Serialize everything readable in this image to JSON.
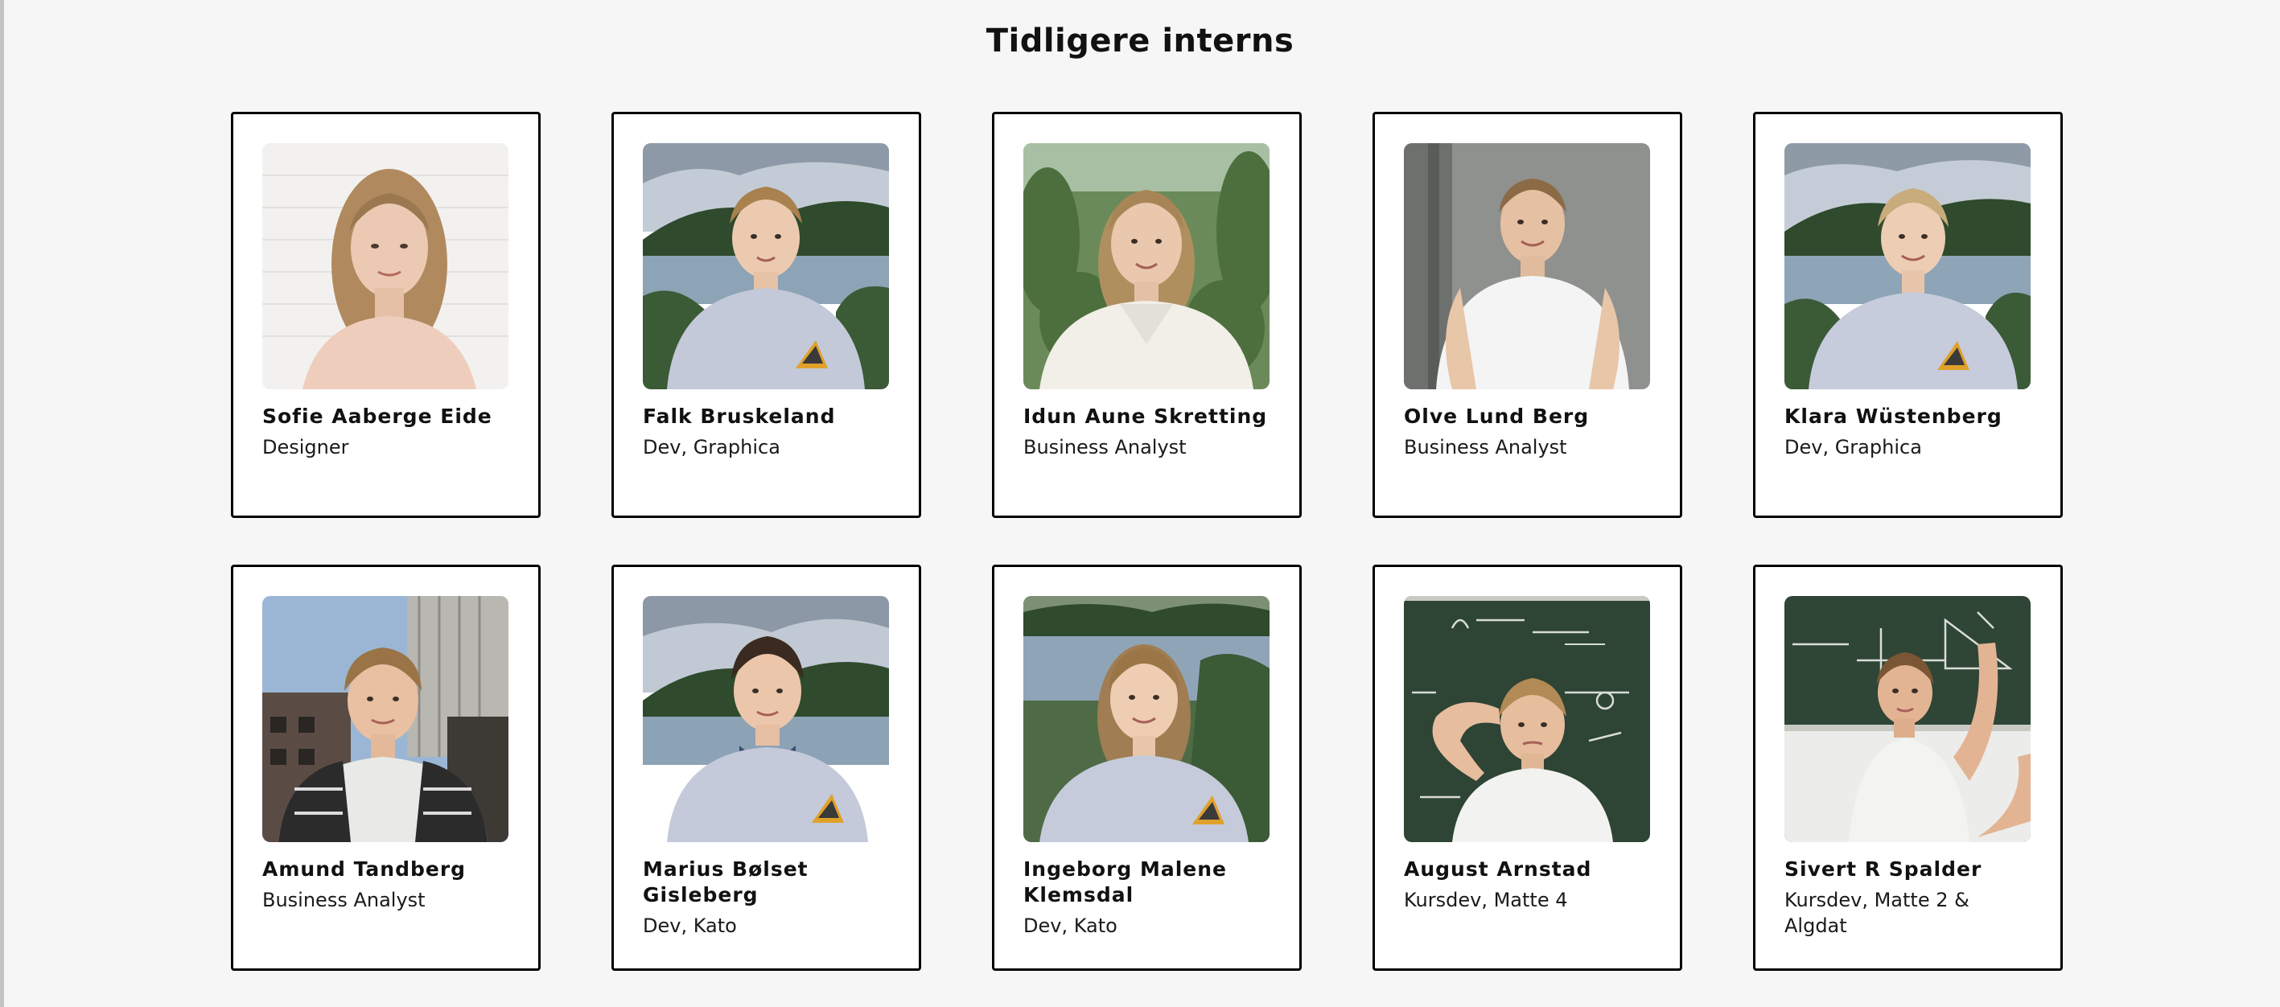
{
  "page_title": "Tidligere interns",
  "interns": [
    {
      "name": "Sofie Aaberge Eide",
      "role": "Designer",
      "photo": "portrait-light-wall"
    },
    {
      "name": "Falk Bruskeland",
      "role": "Dev, Graphica",
      "photo": "portrait-lake-sweater"
    },
    {
      "name": "Idun Aune Skretting",
      "role": "Business Analyst",
      "photo": "portrait-greenery"
    },
    {
      "name": "Olve Lund Berg",
      "role": "Business Analyst",
      "photo": "portrait-grey-wall"
    },
    {
      "name": "Klara Wüstenberg",
      "role": "Dev, Graphica",
      "photo": "portrait-lake-sweater"
    },
    {
      "name": "Amund Tandberg",
      "role": "Business Analyst",
      "photo": "portrait-city-rooftop"
    },
    {
      "name": "Marius Bølset Gisleberg",
      "role": "Dev, Kato",
      "photo": "portrait-lake-sweater"
    },
    {
      "name": "Ingeborg Malene Klemsdal",
      "role": "Dev, Kato",
      "photo": "portrait-lake-sweater"
    },
    {
      "name": "August Arnstad",
      "role": "Kursdev, Matte 4",
      "photo": "portrait-chalkboard"
    },
    {
      "name": "Sivert R Spalder",
      "role": "Kursdev, Matte 2 & Algdat",
      "photo": "portrait-chalkboard"
    }
  ]
}
